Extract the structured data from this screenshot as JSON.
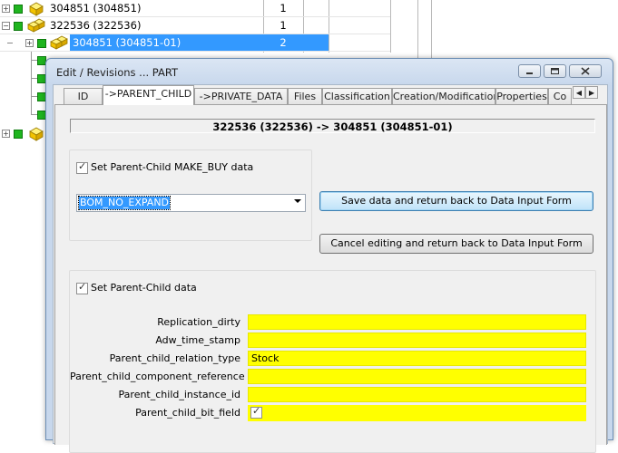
{
  "tree": {
    "rows": [
      {
        "label": "304851 (304851)",
        "count": "1"
      },
      {
        "label": "322536 (322536)",
        "count": "1"
      },
      {
        "label": "304851 (304851-01)",
        "count": "2"
      }
    ]
  },
  "dialog": {
    "title": "Edit / Revisions ... PART",
    "tabs": [
      "ID",
      "->PARENT_CHILD",
      "->PRIVATE_DATA",
      "Files",
      "Classification",
      "Creation/Modification",
      "Properties",
      "Co"
    ],
    "path": "322536 (322536) -> 304851 (304851-01)",
    "make_buy": {
      "checkbox_label": "Set Parent-Child MAKE_BUY data",
      "checked": true,
      "selected_value": "BOM_NO_EXPAND"
    },
    "save_button": "Save data and return back to Data Input Form",
    "cancel_button": "Cancel editing and return back to Data Input Form",
    "parent_child": {
      "checkbox_label": "Set Parent-Child data",
      "checked": true,
      "fields": [
        {
          "label": "Replication_dirty",
          "value": ""
        },
        {
          "label": "Adw_time_stamp",
          "value": ""
        },
        {
          "label": "Parent_child_relation_type",
          "value": "Stock"
        },
        {
          "label": "Parent_child_component_reference",
          "value": ""
        },
        {
          "label": "Parent_child_instance_id",
          "value": ""
        },
        {
          "label": "Parent_child_bit_field",
          "value": "",
          "checkbox": true
        }
      ]
    }
  },
  "colors": {
    "selection": "#3399ff",
    "field_highlight": "#ffff00",
    "tree_node": "#1fb51f"
  }
}
